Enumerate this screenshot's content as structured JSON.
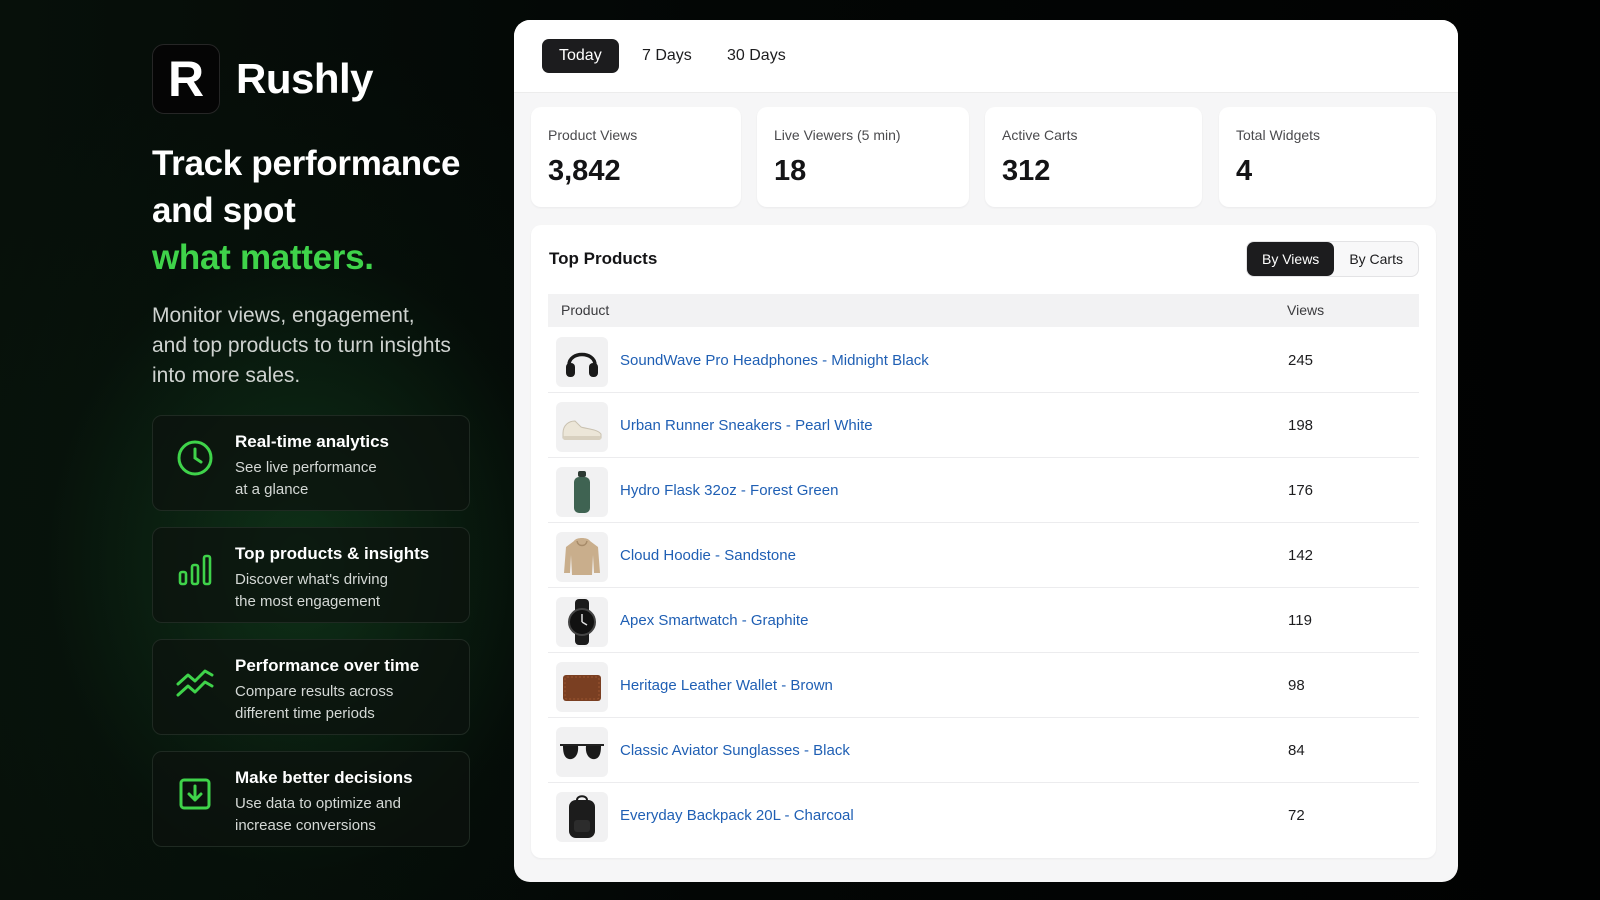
{
  "brand": {
    "logo_letter": "R",
    "name": "Rushly"
  },
  "hero": {
    "headline_line1": "Track performance",
    "headline_line2": "and spot",
    "headline_accent": "what matters.",
    "accent_color": "#3fd34a",
    "subtext": "Monitor views, engagement, and top products to turn insights into more sales."
  },
  "features": [
    {
      "icon": "clock-icon",
      "title": "Real-time analytics",
      "desc_line1": "See live performance",
      "desc_line2": "at a glance"
    },
    {
      "icon": "bar-chart-icon",
      "title": "Top products & insights",
      "desc_line1": "Discover what's driving",
      "desc_line2": "the most engagement"
    },
    {
      "icon": "trend-up-icon",
      "title": "Performance over time",
      "desc_line1": "Compare results across",
      "desc_line2": "different time periods"
    },
    {
      "icon": "download-icon",
      "title": "Make better decisions",
      "desc_line1": "Use data to optimize and",
      "desc_line2": "increase conversions"
    }
  ],
  "dashboard": {
    "tabs": [
      {
        "label": "Today",
        "active": true
      },
      {
        "label": "7 Days",
        "active": false
      },
      {
        "label": "30 Days",
        "active": false
      }
    ],
    "stats": [
      {
        "label": "Product Views",
        "value": "3,842"
      },
      {
        "label": "Live Viewers (5 min)",
        "value": "18"
      },
      {
        "label": "Active Carts",
        "value": "312"
      },
      {
        "label": "Total Widgets",
        "value": "4"
      }
    ],
    "top_products": {
      "title": "Top Products",
      "sort_options": [
        {
          "label": "By Views",
          "active": true
        },
        {
          "label": "By Carts",
          "active": false
        }
      ],
      "columns": [
        "Product",
        "Views"
      ],
      "rows": [
        {
          "thumb": "headphones-icon",
          "name": "SoundWave Pro Headphones - Midnight Black",
          "views": "245"
        },
        {
          "thumb": "sneaker-icon",
          "name": "Urban Runner Sneakers - Pearl White",
          "views": "198"
        },
        {
          "thumb": "bottle-icon",
          "name": "Hydro Flask 32oz - Forest Green",
          "views": "176"
        },
        {
          "thumb": "hoodie-icon",
          "name": "Cloud Hoodie - Sandstone",
          "views": "142"
        },
        {
          "thumb": "smartwatch-icon",
          "name": "Apex Smartwatch - Graphite",
          "views": "119"
        },
        {
          "thumb": "wallet-icon",
          "name": "Heritage Leather Wallet - Brown",
          "views": "98"
        },
        {
          "thumb": "sunglasses-icon",
          "name": "Classic Aviator Sunglasses - Black",
          "views": "84"
        },
        {
          "thumb": "backpack-icon",
          "name": "Everyday Backpack 20L - Charcoal",
          "views": "72"
        }
      ],
      "link_color": "#1f5fb4"
    }
  }
}
